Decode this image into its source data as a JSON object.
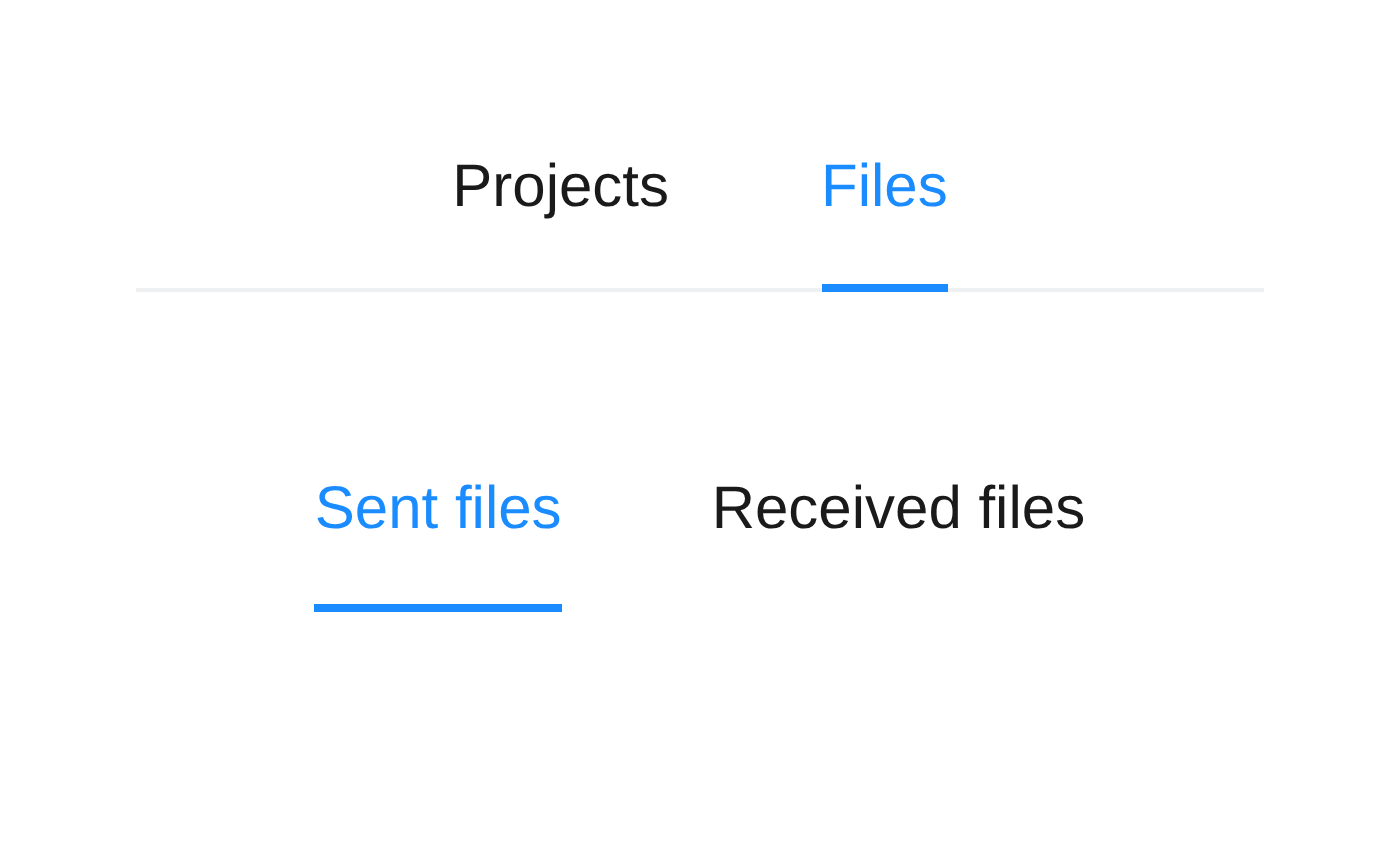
{
  "main_tabs": [
    {
      "label": "Projects",
      "selected": false
    },
    {
      "label": "Files",
      "selected": true
    }
  ],
  "sub_tabs": [
    {
      "label": "Sent files",
      "selected": true
    },
    {
      "label": "Received files",
      "selected": false
    }
  ]
}
